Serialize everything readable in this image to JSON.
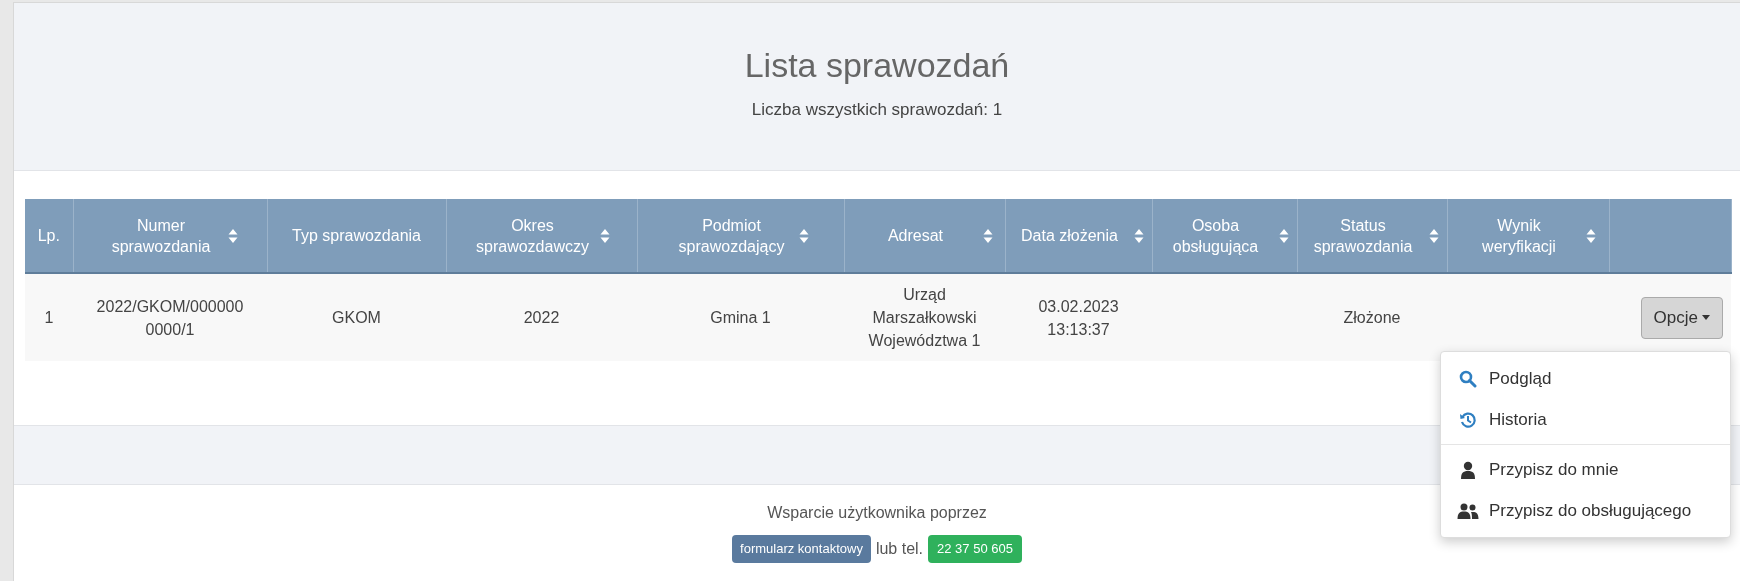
{
  "header": {
    "title": "Lista sprawozdań",
    "subtitle": "Liczba wszystkich sprawozdań: 1"
  },
  "table": {
    "columns": [
      {
        "label": "Lp.",
        "sortable": false
      },
      {
        "label": "Numer sprawozdania",
        "sortable": true
      },
      {
        "label": "Typ sprawozdania",
        "sortable": false
      },
      {
        "label": "Okres sprawozdawczy",
        "sortable": true
      },
      {
        "label": "Podmiot sprawozdający",
        "sortable": true
      },
      {
        "label": "Adresat",
        "sortable": true
      },
      {
        "label": "Data złożenia",
        "sortable": true
      },
      {
        "label": "Osoba obsługująca",
        "sortable": true
      },
      {
        "label": "Status sprawozdania",
        "sortable": true
      },
      {
        "label": "Wynik weryfikacji",
        "sortable": true
      }
    ],
    "rows": [
      {
        "cells": [
          "1",
          "2022/GKOM/000000 0000/1",
          "GKOM",
          "2022",
          "Gmina 1",
          "Urząd Marszałkowski Województwa 1",
          "03.02.2023 13:13:37",
          "",
          "Złożone",
          ""
        ],
        "button": "Opcje"
      }
    ]
  },
  "menu": {
    "items": [
      {
        "kind": "search",
        "label": "Podgląd"
      },
      {
        "kind": "history",
        "label": "Historia"
      },
      {
        "kind": "user",
        "label": "Przypisz do mnie"
      },
      {
        "kind": "users",
        "label": "Przypisz do obsługującego"
      }
    ]
  },
  "footer": {
    "text": "Wsparcie użytkownika poprzez",
    "link": "formularz kontaktowy",
    "between": "lub tel.",
    "phone": "22 37 50 605"
  }
}
